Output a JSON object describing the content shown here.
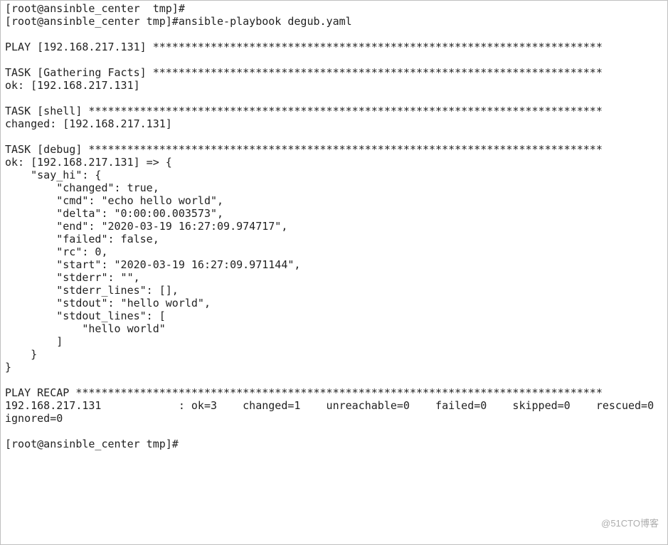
{
  "lines": {
    "prev_trail": "[root@ansinble_center  tmp]#",
    "prompt_call": "[root@ansinble_center tmp]#ansible-playbook degub.yaml",
    "play_header": "PLAY [192.168.217.131] **********************************************************************",
    "task_gather_header": "TASK [Gathering Facts] **********************************************************************",
    "task_gather_status": "ok: [192.168.217.131]",
    "task_shell_header": "TASK [shell] ********************************************************************************",
    "task_shell_status": "changed: [192.168.217.131]",
    "task_debug_header": "TASK [debug] ********************************************************************************",
    "prompt_idle": "[root@ansinble_center tmp]#"
  },
  "debug": {
    "l1": "ok: [192.168.217.131] => {",
    "l2": "    \"say_hi\": {",
    "l3": "        \"changed\": true,",
    "l4": "        \"cmd\": \"echo hello world\",",
    "l5": "        \"delta\": \"0:00:00.003573\",",
    "l6": "        \"end\": \"2020-03-19 16:27:09.974717\",",
    "l7": "        \"failed\": false,",
    "l8": "        \"rc\": 0,",
    "l9": "        \"start\": \"2020-03-19 16:27:09.971144\",",
    "l10": "        \"stderr\": \"\",",
    "l11": "        \"stderr_lines\": [],",
    "l12": "        \"stdout\": \"hello world\",",
    "l13": "        \"stdout_lines\": [",
    "l14": "            \"hello world\"",
    "l15": "        ]",
    "l16": "    }",
    "l17": "}"
  },
  "recap": {
    "header": "PLAY RECAP **********************************************************************************",
    "row": "192.168.217.131            : ok=3    changed=1    unreachable=0    failed=0    skipped=0    rescued=0    ignored=0"
  },
  "watermark": "@51CTO博客"
}
